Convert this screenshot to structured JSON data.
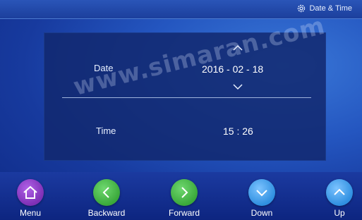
{
  "header": {
    "title": "Date & Time",
    "icon": "gear-icon"
  },
  "settings": {
    "date_label": "Date",
    "date_value": "2016 - 02 - 18",
    "time_label": "Time",
    "time_value": "15 : 26"
  },
  "watermark": "www.simaran.com",
  "nav": {
    "menu": {
      "label": "Menu",
      "icon": "home-icon",
      "color": "#7d2fb5"
    },
    "backward": {
      "label": "Backward",
      "icon": "chevron-left-icon",
      "color": "#3aa83a"
    },
    "forward": {
      "label": "Forward",
      "icon": "chevron-right-icon",
      "color": "#3aa83a"
    },
    "down": {
      "label": "Down",
      "icon": "chevron-down-icon",
      "color": "#2f8fe0"
    },
    "up": {
      "label": "Up",
      "icon": "chevron-up-icon",
      "color": "#2f8fe0"
    }
  }
}
